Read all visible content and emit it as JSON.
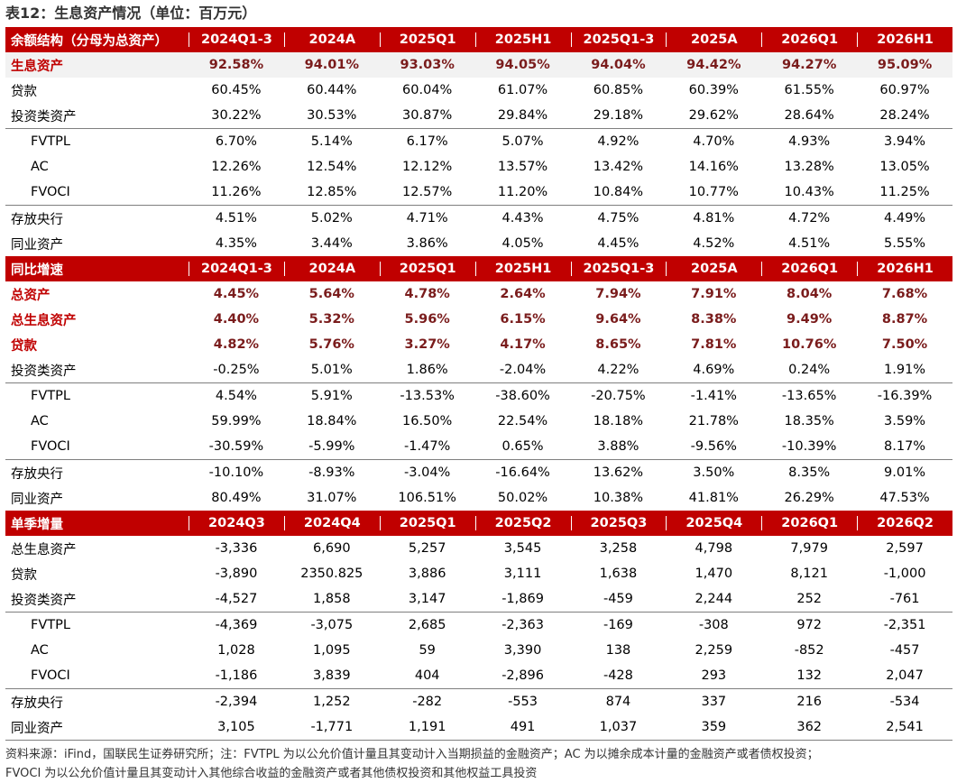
{
  "title": "表12：生息资产情况（单位：百万元）",
  "sections": [
    {
      "header": {
        "label": "余额结构（分母为总资产）",
        "periods": [
          "2024Q1-3",
          "2024A",
          "2025Q1",
          "2025H1",
          "2025Q1-3",
          "2025A",
          "2026Q1",
          "2026H1"
        ]
      },
      "rows": [
        {
          "label": "生息资产",
          "style": "key",
          "values": [
            "92.58%",
            "94.01%",
            "93.03%",
            "94.05%",
            "94.04%",
            "94.42%",
            "94.27%",
            "95.09%"
          ]
        },
        {
          "label": "贷款",
          "style": "",
          "values": [
            "60.45%",
            "60.44%",
            "60.04%",
            "61.07%",
            "60.85%",
            "60.39%",
            "61.55%",
            "60.97%"
          ]
        },
        {
          "label": "投资类资产",
          "style": "gsep",
          "values": [
            "30.22%",
            "30.53%",
            "30.87%",
            "29.84%",
            "29.18%",
            "29.62%",
            "28.64%",
            "28.24%"
          ]
        },
        {
          "label": "FVTPL",
          "style": "sub",
          "values": [
            "6.70%",
            "5.14%",
            "6.17%",
            "5.07%",
            "4.92%",
            "4.70%",
            "4.93%",
            "3.94%"
          ]
        },
        {
          "label": "AC",
          "style": "sub",
          "values": [
            "12.26%",
            "12.54%",
            "12.12%",
            "13.57%",
            "13.42%",
            "14.16%",
            "13.28%",
            "13.05%"
          ]
        },
        {
          "label": "FVOCI",
          "style": "sub gsep",
          "values": [
            "11.26%",
            "12.85%",
            "12.57%",
            "11.20%",
            "10.84%",
            "10.77%",
            "10.43%",
            "11.25%"
          ]
        },
        {
          "label": "存放央行",
          "style": "",
          "values": [
            "4.51%",
            "5.02%",
            "4.71%",
            "4.43%",
            "4.75%",
            "4.81%",
            "4.72%",
            "4.49%"
          ]
        },
        {
          "label": "同业资产",
          "style": "",
          "values": [
            "4.35%",
            "3.44%",
            "3.86%",
            "4.05%",
            "4.45%",
            "4.52%",
            "4.51%",
            "5.55%"
          ]
        }
      ]
    },
    {
      "header": {
        "label": "同比增速",
        "periods": [
          "2024Q1-3",
          "2024A",
          "2025Q1",
          "2025H1",
          "2025Q1-3",
          "2025A",
          "2026Q1",
          "2026H1"
        ]
      },
      "rows": [
        {
          "label": "总资产",
          "style": "bold",
          "values": [
            "4.45%",
            "5.64%",
            "4.78%",
            "2.64%",
            "7.94%",
            "7.91%",
            "8.04%",
            "7.68%"
          ]
        },
        {
          "label": "总生息资产",
          "style": "bold",
          "values": [
            "4.40%",
            "5.32%",
            "5.96%",
            "6.15%",
            "9.64%",
            "8.38%",
            "9.49%",
            "8.87%"
          ]
        },
        {
          "label": "贷款",
          "style": "bold",
          "values": [
            "4.82%",
            "5.76%",
            "3.27%",
            "4.17%",
            "8.65%",
            "7.81%",
            "10.76%",
            "7.50%"
          ]
        },
        {
          "label": "投资类资产",
          "style": "gsep",
          "values": [
            "-0.25%",
            "5.01%",
            "1.86%",
            "-2.04%",
            "4.22%",
            "4.69%",
            "0.24%",
            "1.91%"
          ]
        },
        {
          "label": "FVTPL",
          "style": "sub",
          "values": [
            "4.54%",
            "5.91%",
            "-13.53%",
            "-38.60%",
            "-20.75%",
            "-1.41%",
            "-13.65%",
            "-16.39%"
          ]
        },
        {
          "label": "AC",
          "style": "sub",
          "values": [
            "59.99%",
            "18.84%",
            "16.50%",
            "22.54%",
            "18.18%",
            "21.78%",
            "18.35%",
            "3.59%"
          ]
        },
        {
          "label": "FVOCI",
          "style": "sub gsep",
          "values": [
            "-30.59%",
            "-5.99%",
            "-1.47%",
            "0.65%",
            "3.88%",
            "-9.56%",
            "-10.39%",
            "8.17%"
          ]
        },
        {
          "label": "存放央行",
          "style": "",
          "values": [
            "-10.10%",
            "-8.93%",
            "-3.04%",
            "-16.64%",
            "13.62%",
            "3.50%",
            "8.35%",
            "9.01%"
          ]
        },
        {
          "label": "同业资产",
          "style": "",
          "values": [
            "80.49%",
            "31.07%",
            "106.51%",
            "50.02%",
            "10.38%",
            "41.81%",
            "26.29%",
            "47.53%"
          ]
        }
      ]
    },
    {
      "header": {
        "label": "单季增量",
        "periods": [
          "2024Q3",
          "2024Q4",
          "2025Q1",
          "2025Q2",
          "2025Q3",
          "2025Q4",
          "2026Q1",
          "2026Q2"
        ]
      },
      "rows": [
        {
          "label": "总生息资产",
          "style": "",
          "values": [
            "-3,336",
            "6,690",
            "5,257",
            "3,545",
            "3,258",
            "4,798",
            "7,979",
            "2,597"
          ]
        },
        {
          "label": "贷款",
          "style": "",
          "values": [
            "-3,890",
            "2350.825",
            "3,886",
            "3,111",
            "1,638",
            "1,470",
            "8,121",
            "-1,000"
          ]
        },
        {
          "label": "投资类资产",
          "style": "gsep",
          "values": [
            "-4,527",
            "1,858",
            "3,147",
            "-1,869",
            "-459",
            "2,244",
            "252",
            "-761"
          ]
        },
        {
          "label": "FVTPL",
          "style": "sub",
          "values": [
            "-4,369",
            "-3,075",
            "2,685",
            "-2,363",
            "-169",
            "-308",
            "972",
            "-2,351"
          ]
        },
        {
          "label": "AC",
          "style": "sub",
          "values": [
            "1,028",
            "1,095",
            "59",
            "3,390",
            "138",
            "2,259",
            "-852",
            "-457"
          ]
        },
        {
          "label": "FVOCI",
          "style": "sub gsep",
          "values": [
            "-1,186",
            "3,839",
            "404",
            "-2,896",
            "-428",
            "293",
            "132",
            "2,047"
          ]
        },
        {
          "label": "存放央行",
          "style": "",
          "values": [
            "-2,394",
            "1,252",
            "-282",
            "-553",
            "874",
            "337",
            "216",
            "-534"
          ]
        },
        {
          "label": "同业资产",
          "style": "gsep",
          "values": [
            "3,105",
            "-1,771",
            "1,191",
            "491",
            "1,037",
            "359",
            "362",
            "2,541"
          ]
        }
      ]
    }
  ],
  "footer": {
    "line1": "资料来源：iFind，国联民生证券研究所；注：FVTPL 为以公允价值计量且其变动计入当期损益的金融资产；AC 为以摊余成本计量的金融资产或者债权投资；",
    "line2": "FVOCI 为以公允价值计量且其变动计入其他综合收益的金融资产或者其他债权投资和其他权益工具投资"
  }
}
